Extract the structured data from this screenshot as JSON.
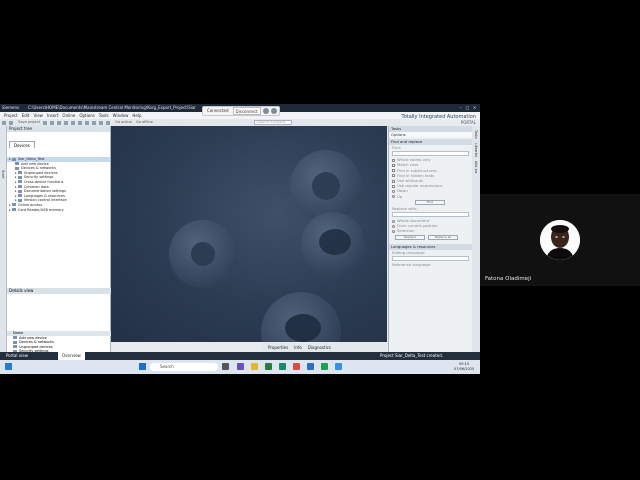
{
  "window": {
    "app_name": "Siemens",
    "path": "C:\\Users\\HOME\\Documents\\Mainstream Central Monitoring\\Korg_Export_Project\\Siar_D"
  },
  "share_bar": {
    "connected": "Connected",
    "disconnect": "Disconnect"
  },
  "menu": [
    "Project",
    "Edit",
    "View",
    "Insert",
    "Online",
    "Options",
    "Tools",
    "Window",
    "Help"
  ],
  "brand": {
    "title": "Totally Integrated Automation",
    "subtitle": "PORTAL"
  },
  "toolbar": {
    "save_label": "Save project",
    "go_online": "Go online",
    "go_offline": "Go offline",
    "search_placeholder": "<Search in project>"
  },
  "project_tree": {
    "header": "Project tree",
    "tab": "Devices",
    "items": [
      "Siar_Delta_Test",
      "Add new device",
      "Devices & networks",
      "Ungrouped devices",
      "Security settings",
      "Cross-device functions",
      "Common data",
      "Documentation settings",
      "Languages & resources",
      "Version control interface",
      "Online access",
      "Card Reader/USB memory"
    ]
  },
  "details_view": {
    "header": "Details view",
    "column": "Name",
    "items": [
      "Add new device",
      "Devices & networks",
      "Ungrouped devices",
      "Security settings",
      "Cross-device functions",
      "Common data"
    ]
  },
  "left_strip": {
    "label": "Start"
  },
  "inspector_tabs": [
    "Properties",
    "Info",
    "Diagnostics"
  ],
  "task_pane": {
    "header": "Tasks",
    "options": "Options",
    "find_replace": "Find and replace",
    "find_label": "Find:",
    "checkboxes": [
      "Whole words only",
      "Match case",
      "Find in substructures",
      "Find in hidden texts",
      "Use wildcards",
      "Use regular expressions"
    ],
    "direction": [
      "Down",
      "Up"
    ],
    "find_button": "Find",
    "replace_label": "Replace with:",
    "scope": [
      "Whole document",
      "From current position",
      "Selection"
    ],
    "replace_button": "Replace",
    "replace_all_button": "Replace all",
    "languages": "Languages & resources",
    "editing_language": "Editing language:",
    "reference_language": "Reference language:"
  },
  "right_strip": [
    "Tasks",
    "Libraries",
    "Add-ins"
  ],
  "portal_bar": {
    "portal_view": "Portal view",
    "overview": "Overview",
    "status": "Project Siar_Delta_Test created."
  },
  "taskbar": {
    "search": "Search",
    "time": "09:15",
    "date": "07/06/2025"
  },
  "participant": {
    "name": "Fatona Oladimeji"
  },
  "colors": {
    "canvas": "#2b3b52",
    "portal_bar": "#242f3d",
    "titlebar": "#1f2a38"
  }
}
